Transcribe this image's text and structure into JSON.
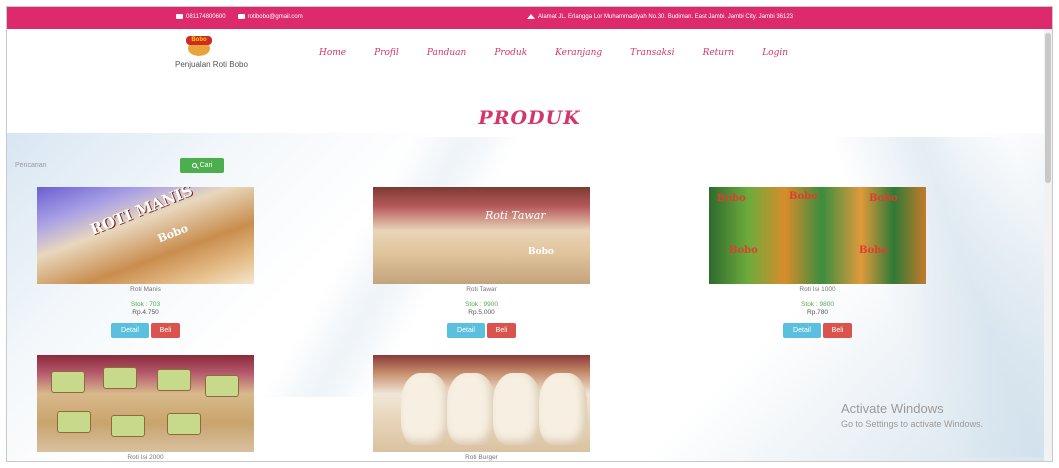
{
  "topbar": {
    "phone": "081174800600",
    "email": "rotibobo@gmail.com",
    "address": "Alamat JL. Erlangga Lor Muhammadiyah No.30. Budiman. East Jambi. Jambi City. Jambi 36123"
  },
  "brand": {
    "logo_text": "Bobo",
    "name": "Penjualan Roti Bobo"
  },
  "nav": [
    "Home",
    "Profil",
    "Panduan",
    "Produk",
    "Keranjang",
    "Transaksi",
    "Return",
    "Login"
  ],
  "page_title": "PRODUK",
  "search": {
    "placeholder": "Pencarian",
    "button_label": "Cari",
    "button_icon": "search-icon"
  },
  "products": [
    {
      "name": "Roti Manis",
      "stock": "Stok : 703",
      "price": "Rp.4.750",
      "img_text": "ROTI MANIS",
      "img_brand": "Bobo",
      "detail_label": "Detail",
      "buy_label": "Beli"
    },
    {
      "name": "Roti Tawar",
      "stock": "Stok : 9900",
      "price": "Rp.5.000",
      "img_text": "Roti Tawar",
      "img_brand": "Bobo",
      "detail_label": "Detail",
      "buy_label": "Beli"
    },
    {
      "name": "Roti Isi 1000",
      "stock": "Stok : 9800",
      "price": "Rp.780",
      "img_text": "Bobo",
      "detail_label": "Detail",
      "buy_label": "Beli"
    },
    {
      "name": "Roti Isi 2000"
    },
    {
      "name": "Roti Burger"
    }
  ],
  "watermark": {
    "line1": "Activate Windows",
    "line2": "Go to Settings to activate Windows."
  },
  "colors": {
    "topbar": "#dc2a6c",
    "accent": "#d6346a",
    "search_button": "#4cae4c",
    "detail_button": "#5bc0de",
    "buy_button": "#d9534f",
    "stock_text": "#4cae4c"
  }
}
